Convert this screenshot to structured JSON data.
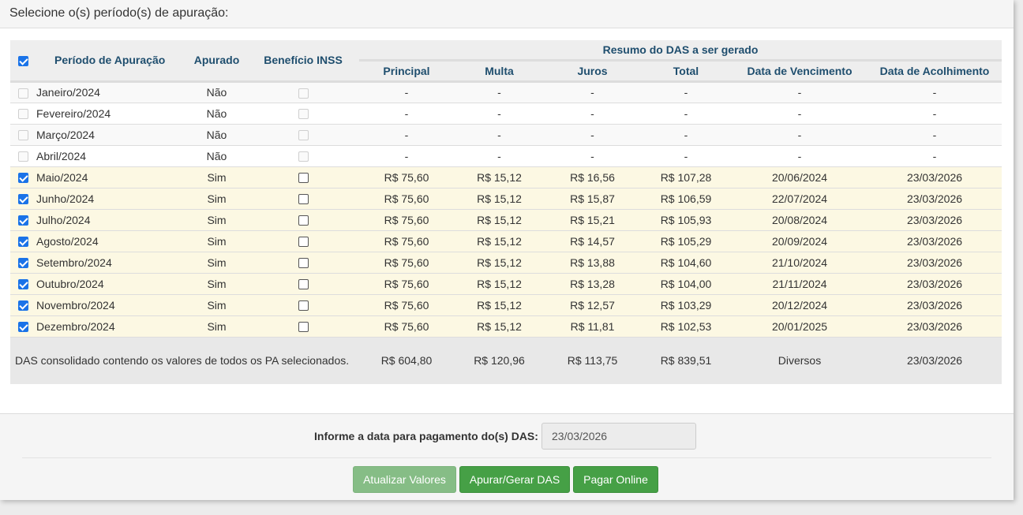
{
  "heading": "Selecione o(s) período(s) de apuração:",
  "table": {
    "headers": {
      "periodo": "Período de Apuração",
      "apurado": "Apurado",
      "beneficio": "Benefício INSS",
      "resumo": "Resumo do DAS a ser gerado",
      "principal": "Principal",
      "multa": "Multa",
      "juros": "Juros",
      "total": "Total",
      "vencimento": "Data de Vencimento",
      "acolhimento": "Data de Acolhimento"
    },
    "select_all_checked": true,
    "rows": [
      {
        "selected": false,
        "periodo": "Janeiro/2024",
        "apurado": "Não",
        "principal": "-",
        "multa": "-",
        "juros": "-",
        "total": "-",
        "vencimento": "-",
        "acolhimento": "-"
      },
      {
        "selected": false,
        "periodo": "Fevereiro/2024",
        "apurado": "Não",
        "principal": "-",
        "multa": "-",
        "juros": "-",
        "total": "-",
        "vencimento": "-",
        "acolhimento": "-"
      },
      {
        "selected": false,
        "periodo": "Março/2024",
        "apurado": "Não",
        "principal": "-",
        "multa": "-",
        "juros": "-",
        "total": "-",
        "vencimento": "-",
        "acolhimento": "-"
      },
      {
        "selected": false,
        "periodo": "Abril/2024",
        "apurado": "Não",
        "principal": "-",
        "multa": "-",
        "juros": "-",
        "total": "-",
        "vencimento": "-",
        "acolhimento": "-"
      },
      {
        "selected": true,
        "periodo": "Maio/2024",
        "apurado": "Sim",
        "principal": "R$ 75,60",
        "multa": "R$ 15,12",
        "juros": "R$ 16,56",
        "total": "R$ 107,28",
        "vencimento": "20/06/2024",
        "acolhimento": "23/03/2026"
      },
      {
        "selected": true,
        "periodo": "Junho/2024",
        "apurado": "Sim",
        "principal": "R$ 75,60",
        "multa": "R$ 15,12",
        "juros": "R$ 15,87",
        "total": "R$ 106,59",
        "vencimento": "22/07/2024",
        "acolhimento": "23/03/2026"
      },
      {
        "selected": true,
        "periodo": "Julho/2024",
        "apurado": "Sim",
        "principal": "R$ 75,60",
        "multa": "R$ 15,12",
        "juros": "R$ 15,21",
        "total": "R$ 105,93",
        "vencimento": "20/08/2024",
        "acolhimento": "23/03/2026"
      },
      {
        "selected": true,
        "periodo": "Agosto/2024",
        "apurado": "Sim",
        "principal": "R$ 75,60",
        "multa": "R$ 15,12",
        "juros": "R$ 14,57",
        "total": "R$ 105,29",
        "vencimento": "20/09/2024",
        "acolhimento": "23/03/2026"
      },
      {
        "selected": true,
        "periodo": "Setembro/2024",
        "apurado": "Sim",
        "principal": "R$ 75,60",
        "multa": "R$ 15,12",
        "juros": "R$ 13,88",
        "total": "R$ 104,60",
        "vencimento": "21/10/2024",
        "acolhimento": "23/03/2026"
      },
      {
        "selected": true,
        "periodo": "Outubro/2024",
        "apurado": "Sim",
        "principal": "R$ 75,60",
        "multa": "R$ 15,12",
        "juros": "R$ 13,28",
        "total": "R$ 104,00",
        "vencimento": "21/11/2024",
        "acolhimento": "23/03/2026"
      },
      {
        "selected": true,
        "periodo": "Novembro/2024",
        "apurado": "Sim",
        "principal": "R$ 75,60",
        "multa": "R$ 15,12",
        "juros": "R$ 12,57",
        "total": "R$ 103,29",
        "vencimento": "20/12/2024",
        "acolhimento": "23/03/2026"
      },
      {
        "selected": true,
        "periodo": "Dezembro/2024",
        "apurado": "Sim",
        "principal": "R$ 75,60",
        "multa": "R$ 15,12",
        "juros": "R$ 11,81",
        "total": "R$ 102,53",
        "vencimento": "20/01/2025",
        "acolhimento": "23/03/2026"
      }
    ],
    "totals": {
      "description": "DAS consolidado contendo os valores de todos os PA selecionados.",
      "principal": "R$ 604,80",
      "multa": "R$ 120,96",
      "juros": "R$ 113,75",
      "total": "R$ 839,51",
      "vencimento": "Diversos",
      "acolhimento": "23/03/2026"
    }
  },
  "footer": {
    "date_label": "Informe a data para pagamento do(s) DAS:",
    "date_value": "23/03/2026",
    "buttons": {
      "atualizar": "Atualizar Valores",
      "apurar": "Apurar/Gerar DAS",
      "pagar": "Pagar Online"
    }
  },
  "colors": {
    "selected_row": "#fcf8e3",
    "header_text": "#1f4e6e",
    "button_green": "#46a046",
    "button_disabled": "#86bd86"
  }
}
